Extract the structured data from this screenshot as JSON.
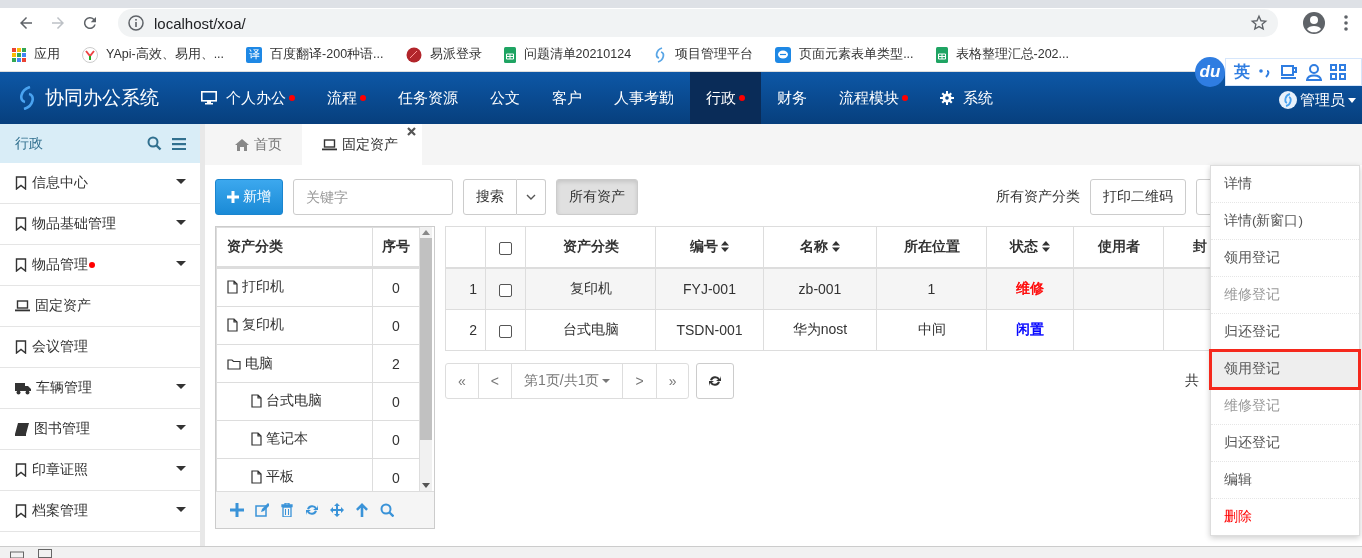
{
  "browser": {
    "address": "localhost/xoa/",
    "bookmarks": [
      {
        "label": "应用"
      },
      {
        "label": "YApi-高效、易用、..."
      },
      {
        "label": "百度翻译-200种语...",
        "badge": "译"
      },
      {
        "label": "易派登录"
      },
      {
        "label": "问题清单20210124"
      },
      {
        "label": "项目管理平台"
      },
      {
        "label": "页面元素表单类型..."
      },
      {
        "label": "表格整理汇总-202..."
      }
    ]
  },
  "ime": {
    "logo": "du",
    "language": "英"
  },
  "nav": {
    "brand": "协同办公系统",
    "user": "管理员",
    "items": [
      {
        "label": "个人办公",
        "dot": true,
        "selected": false
      },
      {
        "label": "流程",
        "dot": true,
        "selected": false
      },
      {
        "label": "任务资源",
        "dot": false,
        "selected": false
      },
      {
        "label": "公文",
        "dot": false,
        "selected": false
      },
      {
        "label": "客户",
        "dot": false,
        "selected": false
      },
      {
        "label": "人事考勤",
        "dot": false,
        "selected": false
      },
      {
        "label": "行政",
        "dot": true,
        "selected": true
      },
      {
        "label": "财务",
        "dot": false,
        "selected": false
      },
      {
        "label": "流程模块",
        "dot": true,
        "selected": false
      },
      {
        "label": "系统",
        "dot": false,
        "selected": false
      }
    ]
  },
  "sidebar": {
    "title": "行政",
    "items": [
      {
        "label": "信息中心",
        "expandable": true,
        "dot": false
      },
      {
        "label": "物品基础管理",
        "expandable": true,
        "dot": false
      },
      {
        "label": "物品管理",
        "expandable": true,
        "dot": true
      },
      {
        "label": "固定资产",
        "expandable": false,
        "dot": false
      },
      {
        "label": "会议管理",
        "expandable": false,
        "dot": false
      },
      {
        "label": "车辆管理",
        "expandable": true,
        "dot": false
      },
      {
        "label": "图书管理",
        "expandable": true,
        "dot": false
      },
      {
        "label": "印章证照",
        "expandable": true,
        "dot": false
      },
      {
        "label": "档案管理",
        "expandable": true,
        "dot": false
      }
    ]
  },
  "tabs": [
    {
      "label": "首页",
      "selected": false,
      "closable": false
    },
    {
      "label": "固定资产",
      "selected": true,
      "closable": true
    }
  ],
  "toolbar": {
    "add": "新增",
    "keyword_placeholder": "关键字",
    "search": "搜索",
    "filter": "所有资产",
    "category_label": "所有资产分类",
    "print": "打印二维码"
  },
  "tree": {
    "columns": [
      "资产分类",
      "序号"
    ],
    "rows": [
      {
        "name": "打印机",
        "count": "0",
        "kind": "file"
      },
      {
        "name": "复印机",
        "count": "0",
        "kind": "file"
      },
      {
        "name": "电脑",
        "count": "2",
        "kind": "folder",
        "children": [
          {
            "name": "台式电脑",
            "count": "0",
            "kind": "file"
          },
          {
            "name": "笔记本",
            "count": "0",
            "kind": "file"
          },
          {
            "name": "平板",
            "count": "0",
            "kind": "file"
          }
        ]
      }
    ]
  },
  "table": {
    "header_checked": false,
    "columns": [
      {
        "label": "资产分类",
        "sortable": false
      },
      {
        "label": "编号",
        "sortable": true
      },
      {
        "label": "名称",
        "sortable": true
      },
      {
        "label": "所在位置",
        "sortable": false
      },
      {
        "label": "状态",
        "sortable": true
      },
      {
        "label": "使用者",
        "sortable": false
      },
      {
        "label": "封",
        "sortable": false
      }
    ],
    "rows": [
      {
        "index": "1",
        "checked": false,
        "cells": [
          "复印机",
          "FYJ-001",
          "zb-001",
          "1"
        ],
        "status": "维修",
        "color": "#ff0000"
      },
      {
        "index": "2",
        "checked": false,
        "cells": [
          "台式电脑",
          "TSDN-001",
          "华为nost",
          "中间"
        ],
        "status": "闲置",
        "color": "#0000ff"
      }
    ]
  },
  "pager": {
    "first": "«",
    "prev": "<",
    "page": "第1页/共1页",
    "next": ">",
    "last": "»",
    "total": "共"
  },
  "context_menu": {
    "items": [
      {
        "label": "详情",
        "disabled": false,
        "danger": false,
        "highlighted": false
      },
      {
        "label": "详情(新窗口)",
        "disabled": false,
        "danger": false,
        "highlighted": false
      },
      {
        "label": "领用登记",
        "disabled": false,
        "danger": false,
        "highlighted": false
      },
      {
        "label": "维修登记",
        "disabled": true,
        "danger": false,
        "highlighted": false
      },
      {
        "label": "归还登记",
        "disabled": false,
        "danger": false,
        "highlighted": false
      },
      {
        "label": "领用登记",
        "disabled": false,
        "danger": false,
        "highlighted": true
      },
      {
        "label": "维修登记",
        "disabled": true,
        "danger": false,
        "highlighted": false
      },
      {
        "label": "归还登记",
        "disabled": false,
        "danger": false,
        "highlighted": false
      },
      {
        "label": "编辑",
        "disabled": false,
        "danger": false,
        "highlighted": false
      },
      {
        "label": "删除",
        "disabled": false,
        "danger": true,
        "highlighted": false
      }
    ]
  }
}
